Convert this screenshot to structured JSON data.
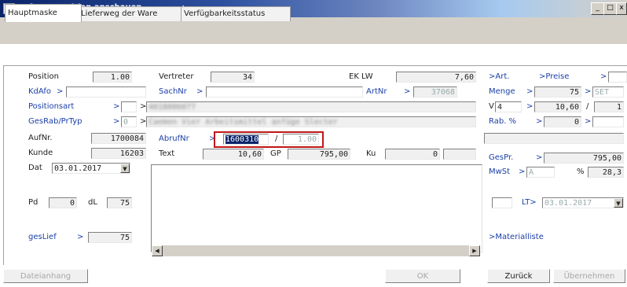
{
  "window": {
    "title": "Auftragsposition anschauen",
    "minimize_label": "_",
    "maximize_label": "□",
    "close_label": "x"
  },
  "tabs": [
    {
      "label": "Hauptmaske"
    },
    {
      "label": "Lieferweg der Ware"
    },
    {
      "label": "Verfügbarkeitsstatus"
    }
  ],
  "form": {
    "position": {
      "label": "Position",
      "value": "1.00"
    },
    "kdafo": {
      "label": "KdAfo",
      "arrow": ">",
      "value": ""
    },
    "positionsart": {
      "label": "Positionsart",
      "arrow": ">",
      "arrow2": ">",
      "value": "",
      "desc": "4018006077"
    },
    "gesrab": {
      "label": "GesRab/PrTyp",
      "arrow": ">",
      "value": "0",
      "arrow2": ">",
      "desc": "Caemen Vier Arbeitsmittel anfüge Slecter"
    },
    "aufnr": {
      "label": "AufNr.",
      "value": "1700084"
    },
    "kunde": {
      "label": "Kunde",
      "value": "16203"
    },
    "dat": {
      "label": "Dat",
      "value": "03.01.2017"
    },
    "pd": {
      "label": "Pd",
      "value": "0"
    },
    "dl": {
      "label": "dL",
      "value": "75"
    },
    "geslief": {
      "label": "gesLief",
      "arrow": ">",
      "value": "75"
    },
    "vertreter": {
      "label": "Vertreter",
      "value": "34"
    },
    "sachnr": {
      "label": "SachNr",
      "arrow": ">",
      "value": ""
    },
    "abrufnr": {
      "label": "AbrufNr",
      "arrow": ">",
      "value": "1600310",
      "slash": "/",
      "value2": "1.00"
    },
    "text": {
      "label": "Text",
      "value": "10,60"
    },
    "gp": {
      "label": "GP",
      "value": "795,00"
    },
    "ku": {
      "label": "Ku",
      "value": "0"
    },
    "eklw": {
      "label": "EK LW",
      "value": "7,60"
    },
    "artnr": {
      "label": "ArtNr",
      "arrow": ">",
      "value": "37068"
    },
    "art": {
      "label": ">Art."
    },
    "preise": {
      "label": ">Preise"
    },
    "preise_arrow": {
      "label": ">"
    },
    "menge": {
      "label": "Menge",
      "arrow": ">",
      "value": "75",
      "arrow2": ">",
      "unit": "SET"
    },
    "v": {
      "label": "V",
      "value": "4",
      "arrow": ">",
      "value2": "10,60",
      "slash": "/",
      "value3": "1"
    },
    "rab": {
      "label": "Rab. %",
      "arrow": ">",
      "value": "0",
      "arrow2": ">"
    },
    "gespr": {
      "label": "GesPr.",
      "arrow": ">",
      "value": "795,00"
    },
    "mwst": {
      "label": "MwSt",
      "arrow": ">",
      "value": "A",
      "pct_label": "%",
      "pct_value": "28,3"
    },
    "lt": {
      "label": "LT>",
      "value": "03.01.2017"
    },
    "materialliste": {
      "label": ">Materialliste"
    }
  },
  "buttons": {
    "dateianhang": "Dateianhang",
    "ok": "OK",
    "zurueck": "Zurück",
    "uebernehmen": "Übernehmen"
  }
}
